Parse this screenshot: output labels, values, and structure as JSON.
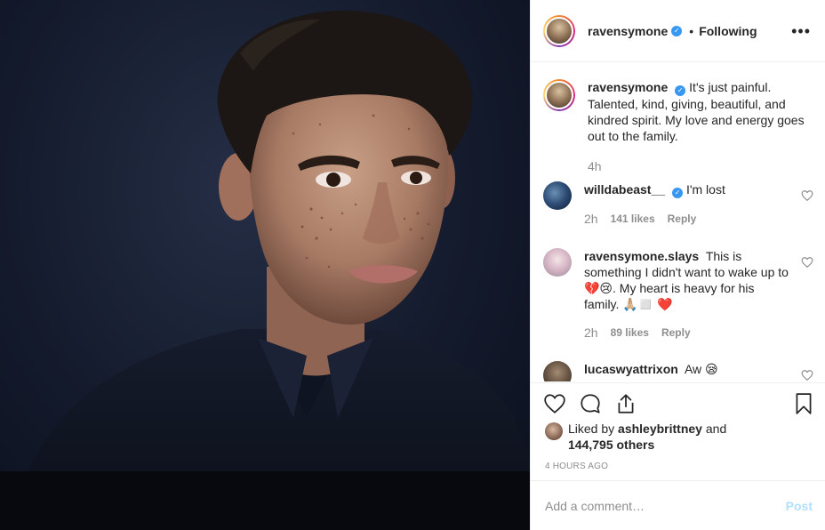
{
  "post": {
    "author": "ravensymone",
    "follow_status": "Following",
    "more_icon": "ellipsis-icon",
    "accent_color": "#3897f0"
  },
  "caption": {
    "username": "ravensymone",
    "text": "It's just painful. Talented, kind, giving, beautiful, and kindred spirit. My love and energy goes out to the family.",
    "time": "4h"
  },
  "comments": [
    {
      "username": "willdabeast__",
      "text": "I'm lost",
      "time": "2h",
      "likes": "141 likes",
      "reply": "Reply"
    },
    {
      "username": "ravensymone.slays",
      "text": "This is something I didn't want to wake up to💔😢. My heart is heavy for his family. 🙏🏼◻️ ❤️",
      "time": "2h",
      "likes": "89 likes",
      "reply": "Reply"
    },
    {
      "username": "lucaswyattrixon",
      "text": "Aw 😪"
    }
  ],
  "likes": {
    "prefix": "Liked by",
    "user": "ashleybrittney",
    "conjunction": "and",
    "others": "144,795 others"
  },
  "timestamp": "4 HOURS AGO",
  "add_comment": {
    "placeholder": "Add a comment…",
    "post_label": "Post"
  }
}
